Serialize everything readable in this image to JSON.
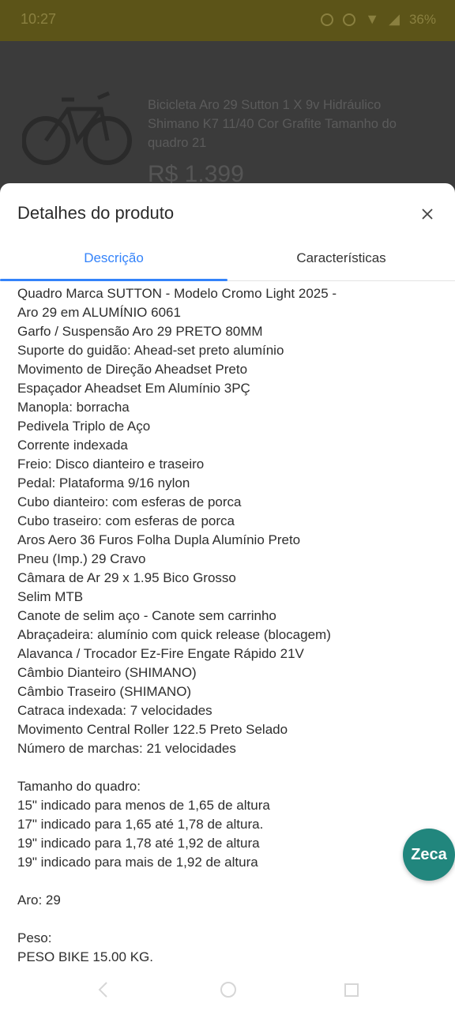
{
  "status_bar": {
    "time": "10:27",
    "battery": "36%"
  },
  "background": {
    "product_title": "Bicicleta Aro 29 Sutton 1 X 9v Hidráulico Shimano K7 11/40 Cor Grafite Tamanho do quadro 21",
    "price": "R$ 1.399"
  },
  "sheet": {
    "title": "Detalhes do produto",
    "tabs": [
      {
        "label": "Descrição",
        "active": true
      },
      {
        "label": "Características",
        "active": false
      }
    ],
    "description_lines": [
      "Quadro Marca SUTTON - Modelo Cromo Light 2025 -",
      "Aro 29 em ALUMÍNIO 6061",
      "Garfo / Suspensão Aro 29 PRETO 80MM",
      "Suporte do guidão: Ahead-set preto alumínio",
      "Movimento de Direção Aheadset Preto",
      "Espaçador Aheadset Em Alumínio 3PÇ",
      "Manopla: borracha",
      "Pedivela Triplo de Aço",
      "Corrente indexada",
      "Freio: Disco dianteiro e traseiro",
      "Pedal: Plataforma 9/16 nylon",
      "Cubo dianteiro: com esferas de porca",
      "Cubo traseiro: com esferas de porca",
      "Aros Aero 36 Furos Folha Dupla Alumínio Preto",
      "Pneu (Imp.) 29 Cravo",
      "Câmara de Ar 29 x 1.95 Bico Grosso",
      "Selim MTB",
      "Canote de selim aço - Canote sem carrinho",
      "Abraçadeira: alumínio com quick release (blocagem)",
      "Alavanca / Trocador Ez-Fire Engate Rápido 21V",
      "Câmbio Dianteiro (SHIMANO)",
      "Câmbio Traseiro (SHIMANO)",
      "Catraca indexada: 7 velocidades",
      "Movimento Central Roller 122.5 Preto Selado",
      "Número de marchas: 21 velocidades",
      "",
      "Tamanho do quadro:",
      "15\" indicado para menos de 1,65 de altura",
      "17\" indicado para 1,65 até 1,78 de altura.",
      "19\" indicado para 1,78 até 1,92 de altura",
      "19\" indicado para mais de 1,92 de altura",
      "",
      "Aro: 29",
      "",
      "Peso:",
      "PESO BIKE 15.00 KG."
    ]
  },
  "assistant": {
    "label": "Zeca"
  },
  "icons": {
    "close": "close-icon",
    "back": "back-icon",
    "home": "home-icon",
    "recents": "recents-icon"
  },
  "colors": {
    "accent": "#3483fa",
    "assistant_bg": "#21867d",
    "status_bar": "#5c5418"
  }
}
